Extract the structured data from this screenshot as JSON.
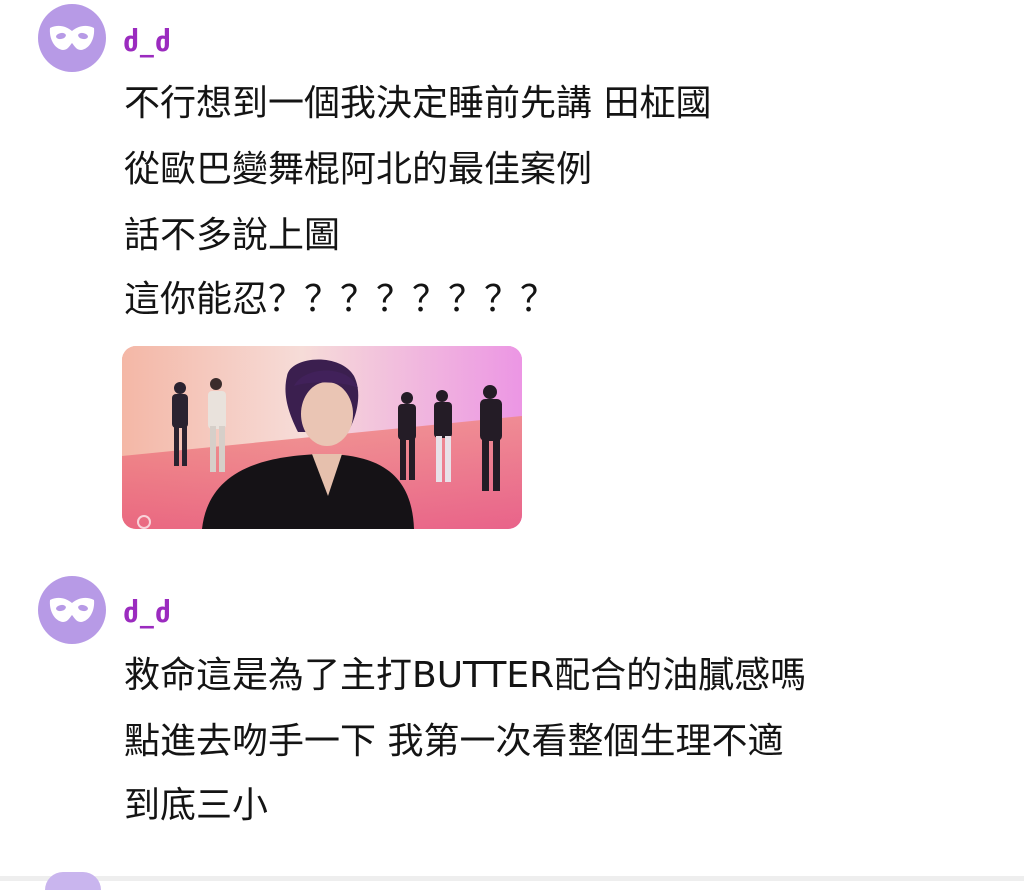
{
  "posts": [
    {
      "username": "ძ_ძ",
      "avatar_icon": "mask-icon",
      "lines": [
        "不行想到一個我決定睡前先講 田柾國",
        "從歐巴變舞棍阿北的最佳案例",
        "話不多說上圖",
        "這你能忍？？？？？？？？"
      ],
      "attachment": "video-thumbnail"
    },
    {
      "username": "ძ_ძ",
      "avatar_icon": "mask-icon",
      "lines": [
        "救命這是為了主打BUTTER配合的油膩感嗎",
        "點進去吻手一下 我第一次看整個生理不適",
        "到底三小"
      ]
    }
  ],
  "colors": {
    "avatar_bg": "#b79ae6",
    "username": "#9b2bbf",
    "text": "#141414"
  }
}
